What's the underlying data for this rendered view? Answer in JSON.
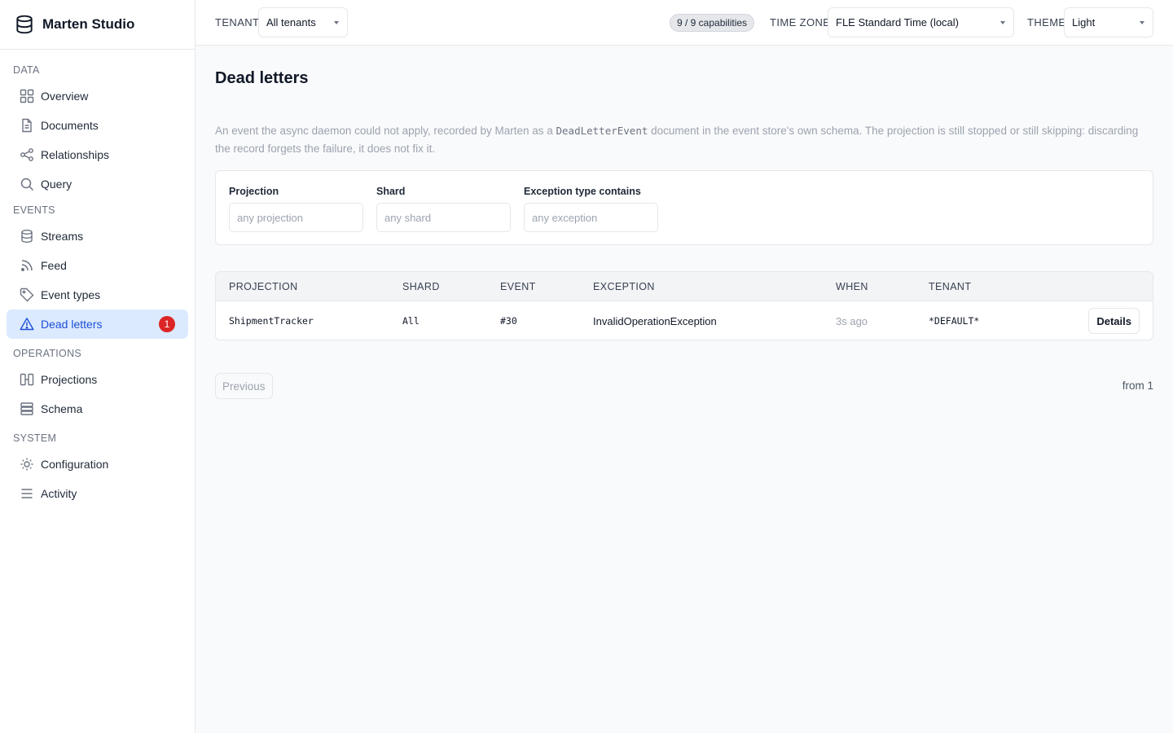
{
  "app": {
    "title": "Marten Studio"
  },
  "sidebar": {
    "sections": [
      {
        "heading": "DATA",
        "items": [
          {
            "label": "Overview",
            "icon": "grid-icon"
          },
          {
            "label": "Documents",
            "icon": "document-icon"
          },
          {
            "label": "Relationships",
            "icon": "share-icon"
          },
          {
            "label": "Query",
            "icon": "search-icon"
          }
        ]
      },
      {
        "heading": "EVENTS",
        "items": [
          {
            "label": "Streams",
            "icon": "database-icon"
          },
          {
            "label": "Feed",
            "icon": "rss-icon"
          },
          {
            "label": "Event types",
            "icon": "tag-icon"
          },
          {
            "label": "Dead letters",
            "icon": "warning-icon",
            "active": true,
            "badge": "1"
          }
        ]
      },
      {
        "heading": "OPERATIONS",
        "items": [
          {
            "label": "Projections",
            "icon": "columns-icon"
          },
          {
            "label": "Schema",
            "icon": "layers-icon"
          }
        ]
      },
      {
        "heading": "SYSTEM",
        "items": [
          {
            "label": "Configuration",
            "icon": "sun-gear-icon"
          },
          {
            "label": "Activity",
            "icon": "list-icon"
          }
        ]
      }
    ]
  },
  "topbar": {
    "tenant_label": "TENANT",
    "tenant_value": "All tenants",
    "capabilities": "9 / 9 capabilities",
    "timezone_label": "TIME ZONE",
    "timezone_value": "FLE Standard Time (local)",
    "theme_label": "THEME",
    "theme_value": "Light"
  },
  "page": {
    "title": "Dead letters",
    "description_part1": "An event the async daemon could not apply, recorded by Marten as a ",
    "description_code": "DeadLetterEvent",
    "description_part2": " document in the event store's own schema. The projection is still stopped or still skipping: discarding the record forgets the failure, it does not fix it."
  },
  "filters": {
    "projection": {
      "label": "Projection",
      "placeholder": "any projection"
    },
    "shard": {
      "label": "Shard",
      "placeholder": "any shard"
    },
    "exception": {
      "label": "Exception type contains",
      "placeholder": "any exception"
    }
  },
  "table": {
    "headers": [
      "PROJECTION",
      "SHARD",
      "EVENT",
      "EXCEPTION",
      "WHEN",
      "TENANT"
    ],
    "rows": [
      {
        "projection": "ShipmentTracker",
        "shard": "All",
        "event": "#30",
        "exception": "InvalidOperationException",
        "when": "3s ago",
        "tenant": "*DEFAULT*",
        "action": "Details"
      }
    ]
  },
  "pagination": {
    "previous": "Previous",
    "info": "from 1"
  },
  "colors": {
    "accent": "#1d4ed8",
    "active_bg": "#dbeafe",
    "badge": "#dc2626"
  }
}
